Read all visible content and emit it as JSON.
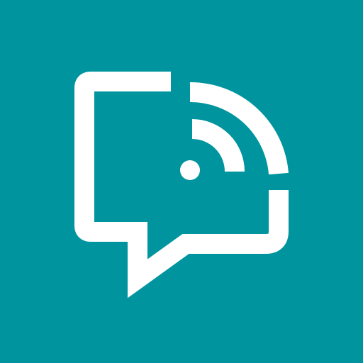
{
  "colors": {
    "background": "#00959e",
    "glyph": "#ffffff"
  },
  "icon": {
    "name": "chat-bubble-broadcast-icon"
  }
}
